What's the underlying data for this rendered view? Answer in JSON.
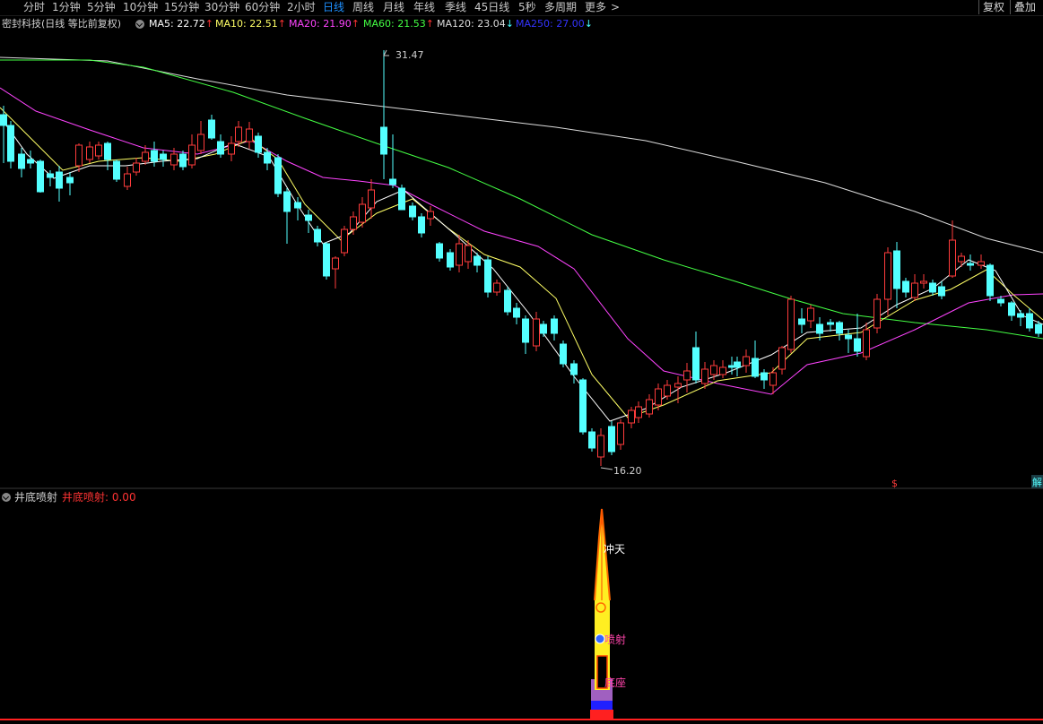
{
  "toolbar": {
    "periods": [
      "分时",
      "1分钟",
      "5分钟",
      "10分钟",
      "15分钟",
      "30分钟",
      "60分钟",
      "2小时",
      "日线",
      "周线",
      "月线",
      "年线",
      "季线",
      "45日线",
      "5秒",
      "多周期",
      "更多"
    ],
    "active_period": "日线",
    "more_arrow": ">",
    "buttons": [
      "复权",
      "叠加"
    ]
  },
  "info": {
    "stock": "密封科技(日线 等比前复权)",
    "ma": [
      {
        "label": "MA5: 22.72",
        "arrow": "↑",
        "color": "#ffffff",
        "arrow_color": "#ff3333"
      },
      {
        "label": "MA10: 22.51",
        "arrow": "↑",
        "color": "#ffff66",
        "arrow_color": "#ff3333"
      },
      {
        "label": "MA20: 21.90",
        "arrow": "↑",
        "color": "#ff44ff",
        "arrow_color": "#ff3333"
      },
      {
        "label": "MA60: 21.53",
        "arrow": "↑",
        "color": "#44ff44",
        "arrow_color": "#ff3333"
      },
      {
        "label": "MA120: 23.04",
        "arrow": "↓",
        "color": "#dddddd",
        "arrow_color": "#44ffff"
      },
      {
        "label": "MA250: 27.00",
        "arrow": "↓",
        "color": "#3333ff",
        "arrow_color": "#44ffff"
      }
    ]
  },
  "chart": {
    "high_label": "31.47",
    "low_label": "16.20",
    "dollar_mark": "$",
    "edge_mark": "解",
    "colors": {
      "up": "#ff3c3c",
      "down": "#54ffff",
      "ma5": "#ffffff",
      "ma10": "#ffff66",
      "ma20": "#ff44ff",
      "ma60": "#44ff44",
      "ma120": "#dcdcdc"
    }
  },
  "indicator": {
    "name": "井底喷射",
    "value_label": "井底喷射: 0.00",
    "labels": {
      "top": "冲天",
      "mid": "喷射",
      "low": "底座"
    }
  }
}
